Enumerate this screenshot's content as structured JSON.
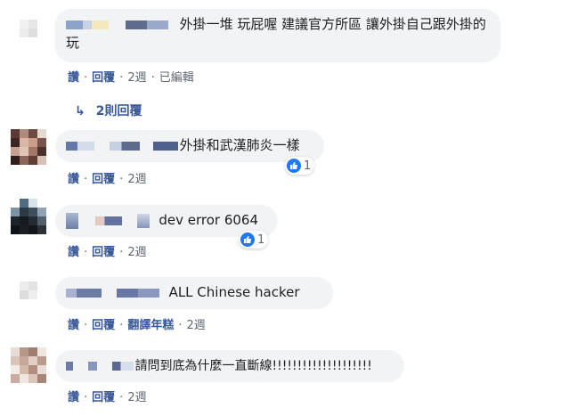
{
  "comments": [
    {
      "text": "外掛一堆 玩屁喔 建議官方所區 讓外掛自己跟外掛的玩",
      "actions": [
        "讚",
        "回覆",
        "2週",
        "已編輯"
      ],
      "replies": "2則回覆"
    },
    {
      "text": "外掛和武漢肺炎一樣",
      "actions": [
        "讚",
        "回覆",
        "2週"
      ],
      "reaction_count": "1"
    },
    {
      "text": "dev error 6064",
      "actions": [
        "讚",
        "回覆",
        "2週"
      ],
      "reaction_count": "1"
    },
    {
      "text": "ALL Chinese hacker",
      "actions": [
        "讚",
        "回覆",
        "翻譯年糕",
        "2週"
      ]
    },
    {
      "text": "請問到底為什麼一直斷線!!!!!!!!!!!!!!!!!!!!",
      "actions": [
        "讚",
        "回覆",
        "2週"
      ]
    }
  ],
  "colors": {
    "bubble": "#f2f3f5",
    "link": "#385898",
    "meta": "#606770",
    "like": "#2078f4"
  },
  "icons": {
    "reply_arrow": "reply-arrow-icon",
    "like": "like-icon"
  }
}
